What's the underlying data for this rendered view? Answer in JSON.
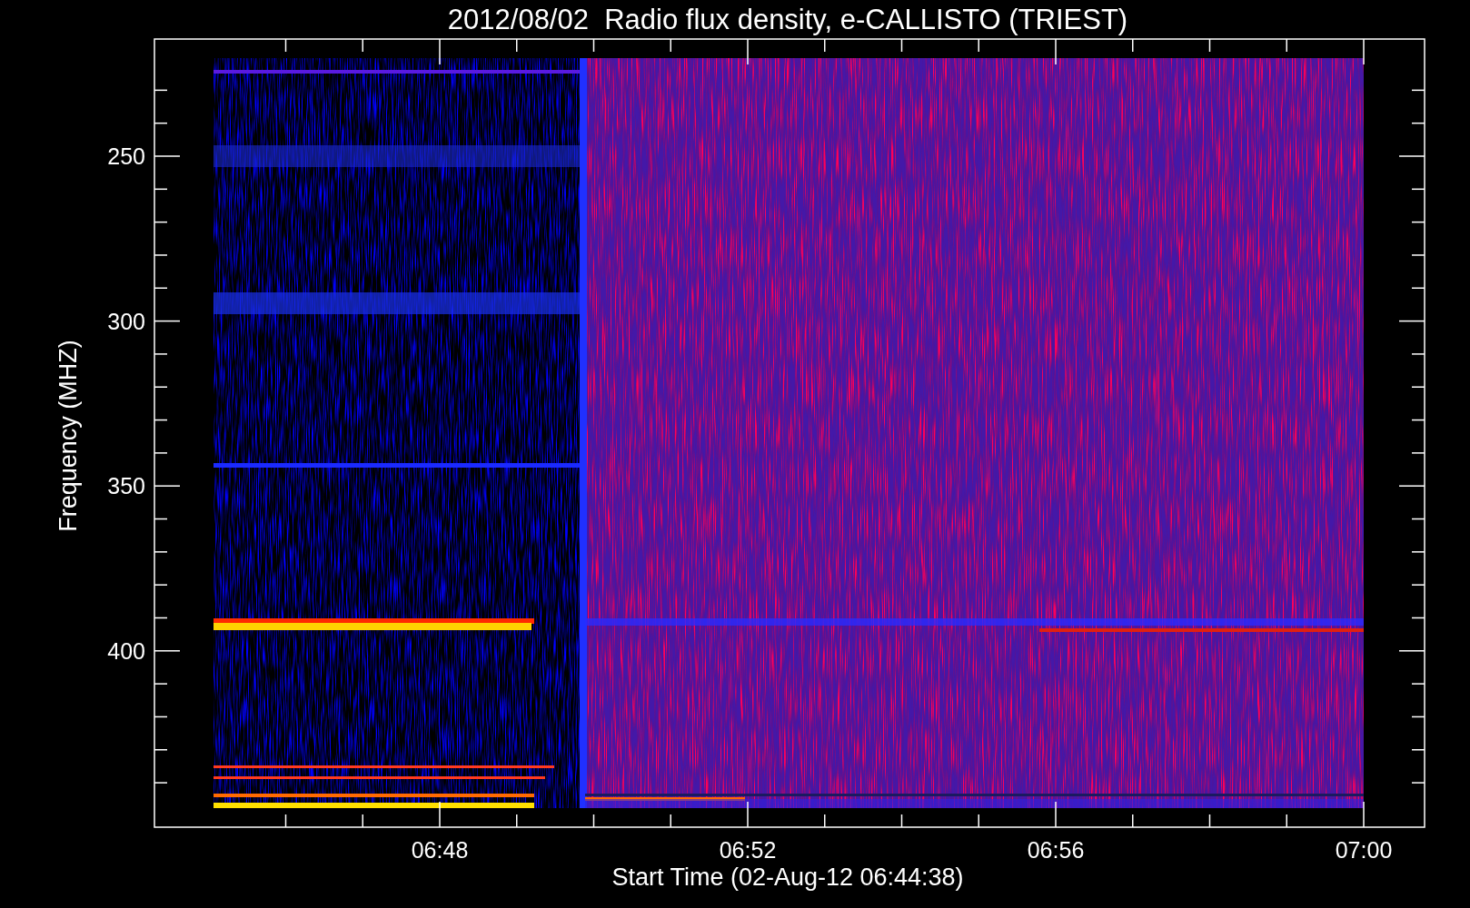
{
  "title": "2012/08/02  Radio flux density, e-CALLISTO (TRIEST)",
  "y_axis": {
    "label": "Frequency (MHZ)",
    "ticks": [
      "250",
      "300",
      "350",
      "400"
    ]
  },
  "x_axis": {
    "label": "Start Time (02-Aug-12 06:44:38)",
    "ticks": [
      "06:48",
      "06:52",
      "06:56",
      "07:00"
    ]
  }
}
